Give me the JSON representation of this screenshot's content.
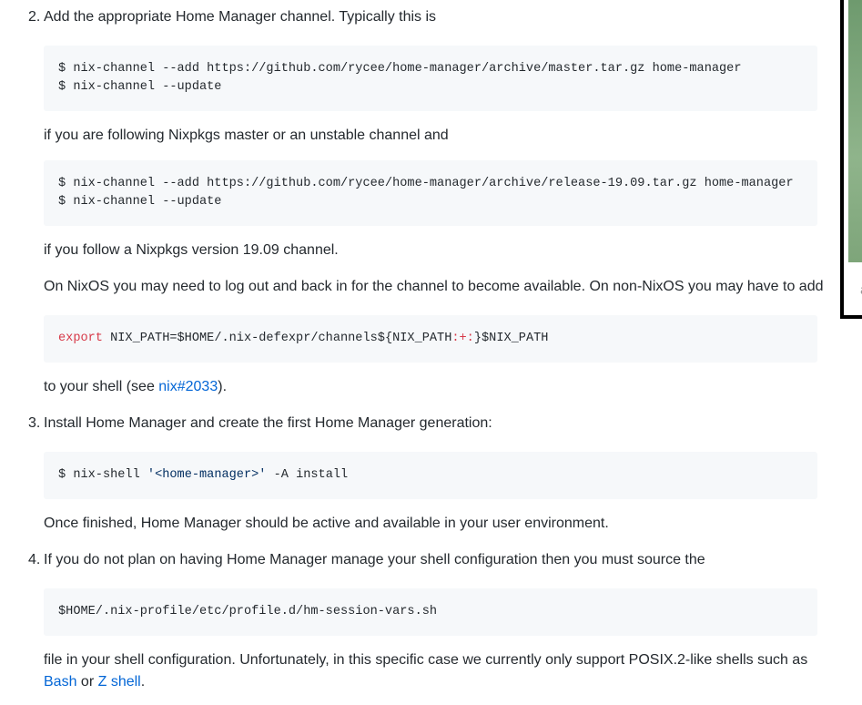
{
  "steps": [
    {
      "number": "2.",
      "intro": "Add the appropriate Home Manager channel. Typically this is",
      "code1": [
        "$ nix-channel --add https://github.com/rycee/home-manager/archive/master.tar.gz home-manager",
        "$ nix-channel --update"
      ],
      "after1": "if you are following Nixpkgs master or an unstable channel and",
      "code2": [
        "$ nix-channel --add https://github.com/rycee/home-manager/archive/release-19.09.tar.gz home-manager",
        "$ nix-channel --update"
      ],
      "after2": "if you follow a Nixpkgs version 19.09 channel.",
      "para3": "On NixOS you may need to log out and back in for the channel to become available. On non-NixOS you may have to add",
      "code3": {
        "kw": "export",
        "rest_a": " NIX_PATH=$HOME/.nix-defexpr/channels${NIX_PATH",
        "op": ":+:",
        "rest_b": "}$NIX_PATH"
      },
      "after3_prefix": "to your shell (see ",
      "after3_link": "nix#2033",
      "after3_suffix": ")."
    },
    {
      "number": "3.",
      "intro": "Install Home Manager and create the first Home Manager generation:",
      "code_prefix": "$ nix-shell ",
      "code_string": "'<home-manager>'",
      "code_suffix": " -A install",
      "after": "Once finished, Home Manager should be active and available in your user environment."
    },
    {
      "number": "4.",
      "intro": "If you do not plan on having Home Manager manage your shell configuration then you must source the",
      "code": "$HOME/.nix-profile/etc/profile.d/hm-session-vars.sh",
      "after_prefix": "file in your shell configuration. Unfortunately, in this specific case we currently only support POSIX.2-like shells such as",
      "link1": "Bash",
      "mid": " or ",
      "link2": "Z shell",
      "after_suffix": "."
    }
  ],
  "sidebar": {
    "text": "a"
  },
  "colors": {
    "link": "#0366d6",
    "code_bg": "#f6f8fa",
    "keyword": "#d73a49",
    "string": "#032f62"
  }
}
